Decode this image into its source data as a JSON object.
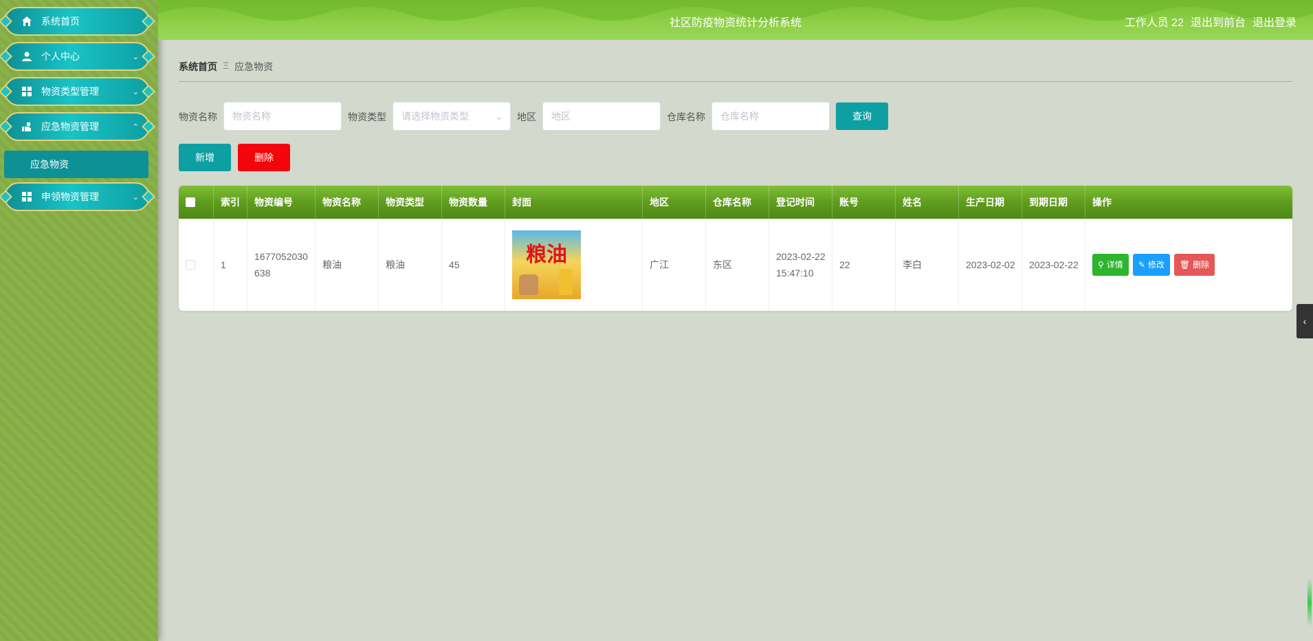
{
  "header": {
    "title": "社区防疫物资统计分析系统",
    "user_label": "工作人员 22",
    "front_link": "退出到前台",
    "logout_link": "退出登录"
  },
  "sidebar": {
    "items": [
      {
        "label": "系统首页",
        "icon": "home-icon"
      },
      {
        "label": "个人中心",
        "icon": "user-icon"
      },
      {
        "label": "物资类型管理",
        "icon": "grid-icon"
      },
      {
        "label": "应急物资管理",
        "icon": "hand-icon"
      },
      {
        "label": "申领物资管理",
        "icon": "grid-icon"
      }
    ],
    "sub_item": "应急物资"
  },
  "breadcrumb": {
    "home": "系统首页",
    "sep": "Ξ",
    "current": "应急物资"
  },
  "search": {
    "name_label": "物资名称",
    "name_placeholder": "物资名称",
    "type_label": "物资类型",
    "type_placeholder": "请选择物资类型",
    "area_label": "地区",
    "area_placeholder": "地区",
    "warehouse_label": "仓库名称",
    "warehouse_placeholder": "仓库名称",
    "query_button": "查询"
  },
  "actions": {
    "add": "新增",
    "delete": "删除"
  },
  "table": {
    "columns": [
      "索引",
      "物资编号",
      "物资名称",
      "物资类型",
      "物资数量",
      "封面",
      "地区",
      "仓库名称",
      "登记时间",
      "账号",
      "姓名",
      "生产日期",
      "到期日期",
      "操作"
    ],
    "rows": [
      {
        "index": "1",
        "code": "1677052030638",
        "name": "粮油",
        "type": "粮油",
        "qty": "45",
        "cover_text": "粮油",
        "area": "广江",
        "warehouse": "东区",
        "reg_time": "2023-02-22 15:47:10",
        "account": "22",
        "person": "李白",
        "prod_date": "2023-02-02",
        "exp_date": "2023-02-22",
        "ops": {
          "detail": "详情",
          "edit": "修改",
          "delete": "删除"
        }
      }
    ]
  },
  "colors": {
    "accent_teal": "#0e9fa2",
    "danger_red": "#f2060c",
    "header_green": "#5f9c1e",
    "detail_green": "#2db52d",
    "edit_blue": "#1a9fff",
    "delete_pink": "#e45858"
  }
}
